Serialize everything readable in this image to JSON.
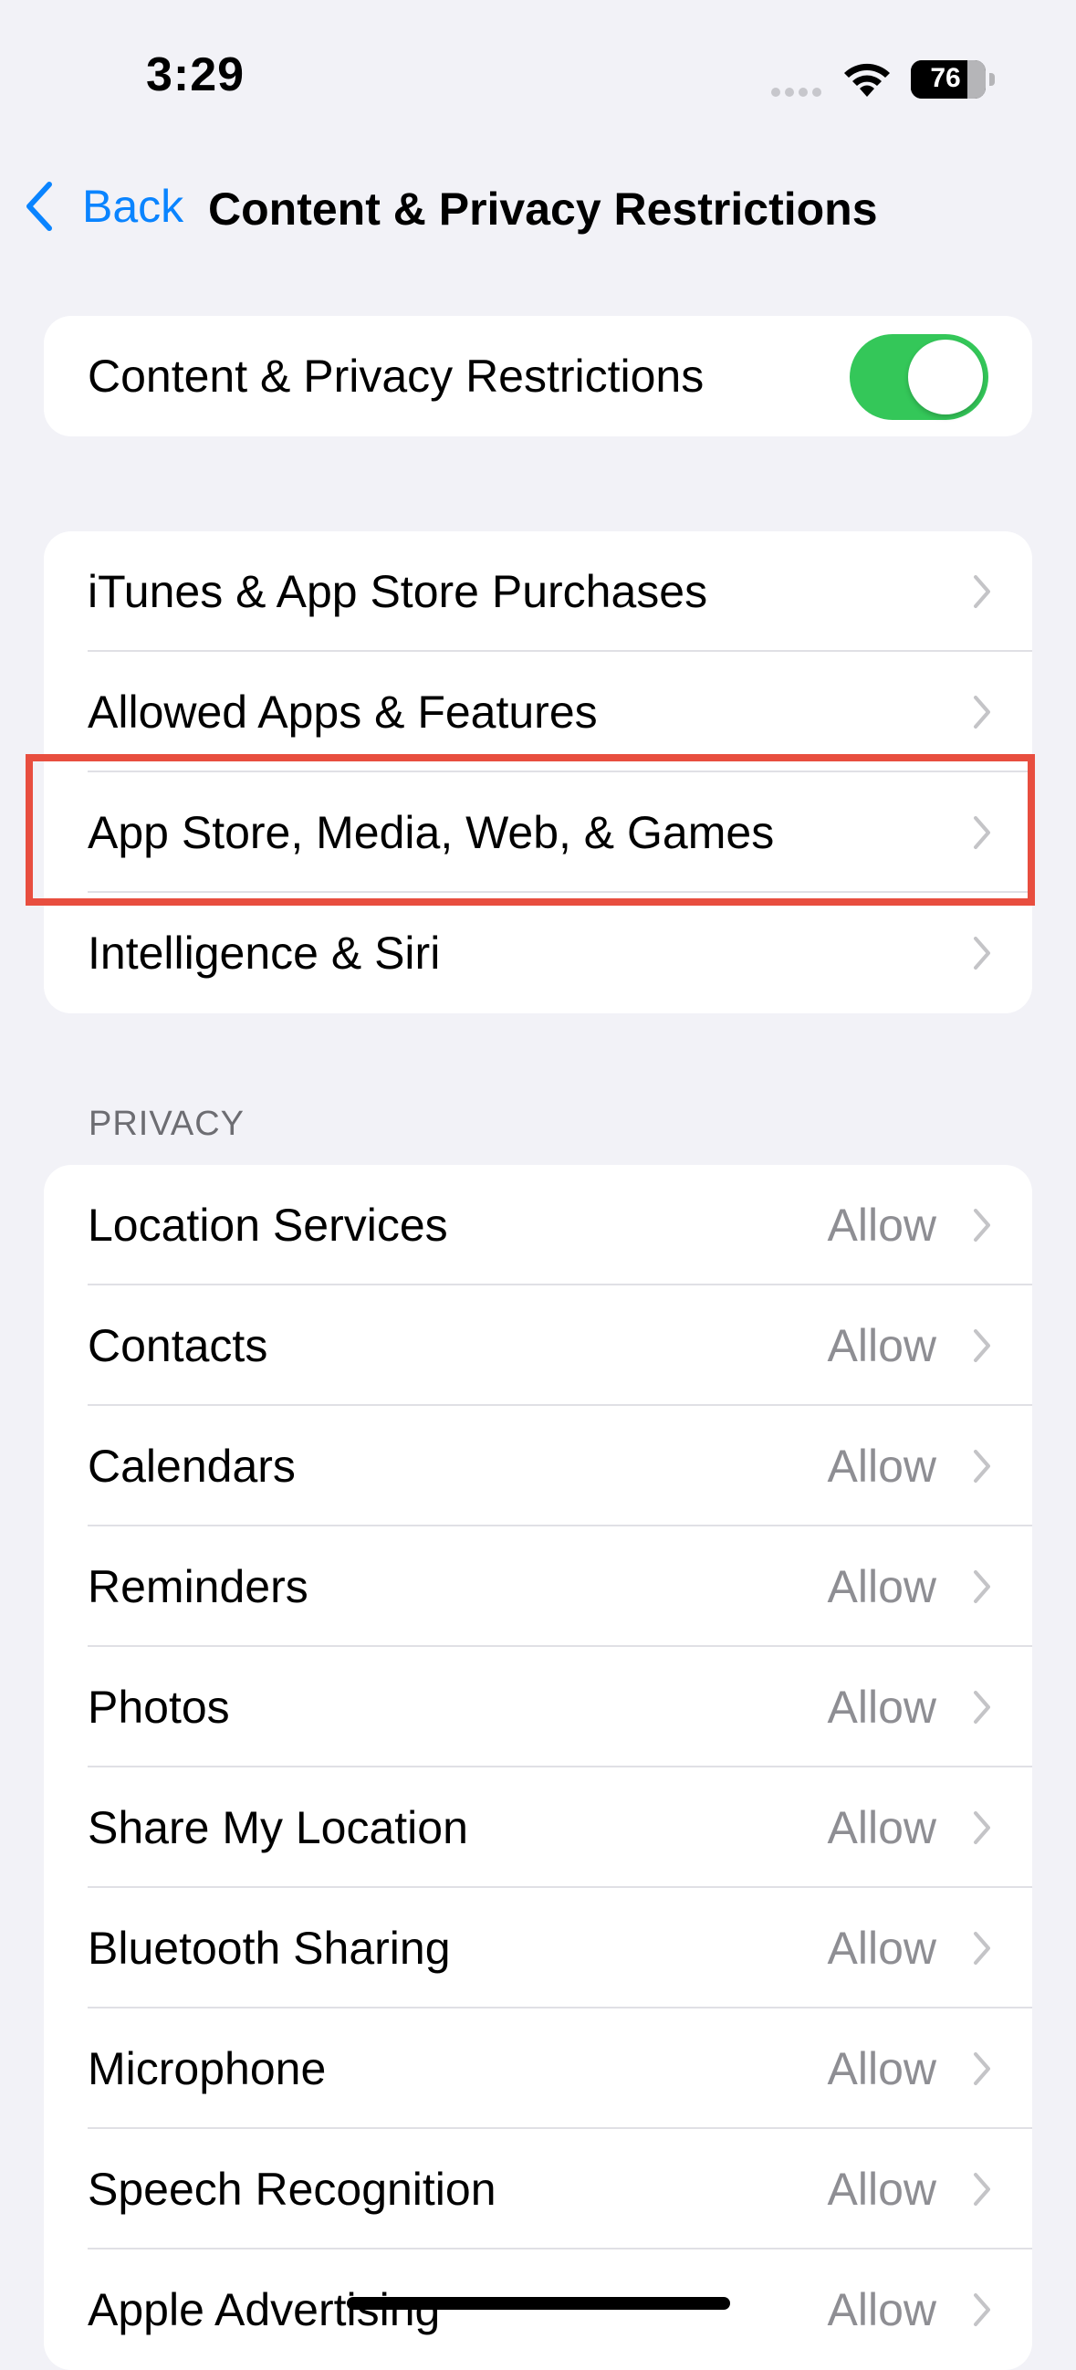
{
  "status_bar": {
    "time": "3:29",
    "battery_level": "76"
  },
  "nav": {
    "back_label": "Back",
    "title": "Content & Privacy Restrictions"
  },
  "master_toggle": {
    "label": "Content & Privacy Restrictions",
    "on": true,
    "color": "#34c759"
  },
  "settings_group": [
    {
      "label": "iTunes & App Store Purchases"
    },
    {
      "label": "Allowed Apps & Features"
    },
    {
      "label": "App Store, Media, Web, & Games"
    },
    {
      "label": "Intelligence & Siri"
    }
  ],
  "privacy": {
    "header": "PRIVACY",
    "items": [
      {
        "label": "Location Services",
        "value": "Allow"
      },
      {
        "label": "Contacts",
        "value": "Allow"
      },
      {
        "label": "Calendars",
        "value": "Allow"
      },
      {
        "label": "Reminders",
        "value": "Allow"
      },
      {
        "label": "Photos",
        "value": "Allow"
      },
      {
        "label": "Share My Location",
        "value": "Allow"
      },
      {
        "label": "Bluetooth Sharing",
        "value": "Allow"
      },
      {
        "label": "Microphone",
        "value": "Allow"
      },
      {
        "label": "Speech Recognition",
        "value": "Allow"
      },
      {
        "label": "Apple Advertising",
        "value": "Allow"
      }
    ]
  },
  "colors": {
    "accent": "#0a84ff",
    "highlight": "#e84e3f",
    "secondary_text": "#8e8e93"
  }
}
